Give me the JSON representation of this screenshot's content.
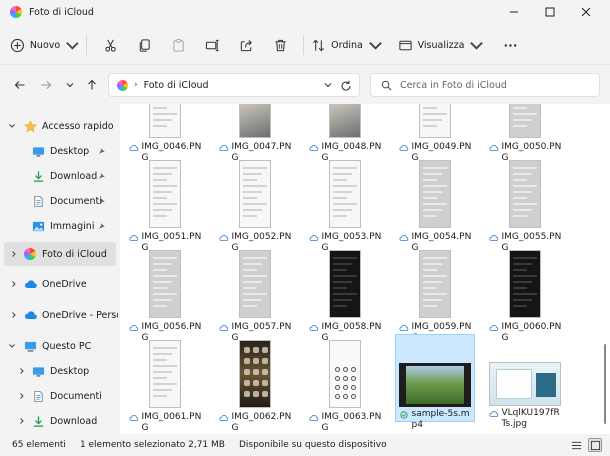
{
  "window": {
    "title": "Foto di iCloud"
  },
  "commandbar": {
    "new_label": "Nuovo",
    "sort_label": "Ordina",
    "view_label": "Visualizza"
  },
  "address": {
    "location": "Foto di iCloud",
    "search_placeholder": "Cerca in Foto di iCloud"
  },
  "sidebar": {
    "items": [
      {
        "label": "Accesso rapido",
        "icon": "star-icon"
      },
      {
        "label": "Desktop",
        "icon": "desktop-icon"
      },
      {
        "label": "Download",
        "icon": "download-icon"
      },
      {
        "label": "Documenti",
        "icon": "documents-icon"
      },
      {
        "label": "Immagini",
        "icon": "pictures-icon"
      },
      {
        "label": "Foto di iCloud",
        "icon": "icloud-photos-icon"
      },
      {
        "label": "OneDrive",
        "icon": "onedrive-icon"
      },
      {
        "label": "OneDrive - Perso",
        "icon": "onedrive-icon"
      },
      {
        "label": "Questo PC",
        "icon": "pc-icon"
      },
      {
        "label": "Desktop",
        "icon": "desktop-icon"
      },
      {
        "label": "Documenti",
        "icon": "documents-icon"
      },
      {
        "label": "Download",
        "icon": "download-icon"
      }
    ]
  },
  "files": [
    {
      "name": "IMG_0046.PNG",
      "style": "light"
    },
    {
      "name": "IMG_0047.PNG",
      "style": "photo"
    },
    {
      "name": "IMG_0048.PNG",
      "style": "photo"
    },
    {
      "name": "IMG_0049.PNG",
      "style": "light"
    },
    {
      "name": "IMG_0050.PNG",
      "style": "grey"
    },
    {
      "name": "IMG_0051.PNG",
      "style": "light"
    },
    {
      "name": "IMG_0052.PNG",
      "style": "light"
    },
    {
      "name": "IMG_0053.PNG",
      "style": "light"
    },
    {
      "name": "IMG_0054.PNG",
      "style": "grey"
    },
    {
      "name": "IMG_0055.PNG",
      "style": "grey"
    },
    {
      "name": "IMG_0056.PNG",
      "style": "grey"
    },
    {
      "name": "IMG_0057.PNG",
      "style": "grey"
    },
    {
      "name": "IMG_0058.PNG",
      "style": "dark"
    },
    {
      "name": "IMG_0059.PNG",
      "style": "grey"
    },
    {
      "name": "IMG_0060.PNG",
      "style": "dark"
    },
    {
      "name": "IMG_0061.PNG",
      "style": "light"
    },
    {
      "name": "IMG_0062.PNG",
      "style": "homescreen"
    },
    {
      "name": "IMG_0063.PNG",
      "style": "keypad"
    },
    {
      "name": "sample-5s.mp4",
      "style": "video"
    },
    {
      "name": "VLqlKU197fRTs.jpg",
      "style": "screenshot"
    }
  ],
  "status": {
    "count": "65 elementi",
    "selection": "1 elemento selezionato  2,71 MB",
    "availability": "Disponibile su questo dispositivo"
  },
  "colors": {
    "cloud_icon": "#2b7cd3",
    "selection_fill": "#cce8ff",
    "selection_border": "#99d1ff",
    "available_check": "#1f8a3b"
  }
}
